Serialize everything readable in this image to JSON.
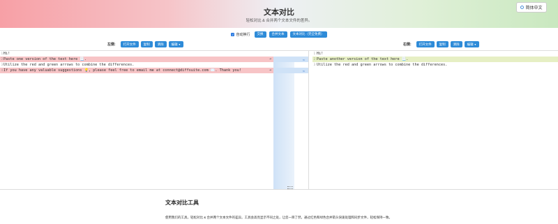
{
  "header": {
    "title": "文本对比",
    "subtitle": "轻松对比 & 合并两个文本文件的差异。",
    "lang_button": "简体中文"
  },
  "toolbar": {
    "auto_wrap": "自动换行",
    "swap": "交换",
    "merge": "合并文本",
    "compare": "文本对比（完全免费）"
  },
  "left_side": {
    "label": "左侧:",
    "open_file": "打开文件",
    "copy": "复制",
    "clear": "清除",
    "edit": "编辑"
  },
  "right_side": {
    "label": "右侧:",
    "open_file": "打开文件",
    "copy": "复制",
    "clear": "清除",
    "edit": "编辑"
  },
  "left_lines": [
    {
      "num": "1",
      "text": "Hi!"
    },
    {
      "num": "2",
      "text": "Paste one version of the text here 📃."
    },
    {
      "num": "3",
      "text": "Utilize the red and green arrows to combine the differences."
    },
    {
      "num": "4",
      "text": "If you have any valuable suggestions 💡, please feel free to email me at connect@diffsuite.com ✉️. Thank you!"
    }
  ],
  "right_lines": [
    {
      "num": "1",
      "text": "Hi!"
    },
    {
      "num": "2",
      "text": "Paste another version of the text here 📃."
    },
    {
      "num": "3",
      "text": "Utilize the red and green arrows to combine the differences."
    }
  ],
  "section": {
    "heading": "文本对比工具",
    "body": "使用我们的工具，轻松对比 & 合并两个文本文件的差异。工具会高亮显示不同之处，让您一目了然。通过红色和绿色合并箭头快速处理和同步文件，轻松保持一致。"
  },
  "colors": {
    "button": "#2e8bd8",
    "deleted_line": "#f7c4c6",
    "added_line": "#e6efc4",
    "connector": "#cfe2f7"
  }
}
